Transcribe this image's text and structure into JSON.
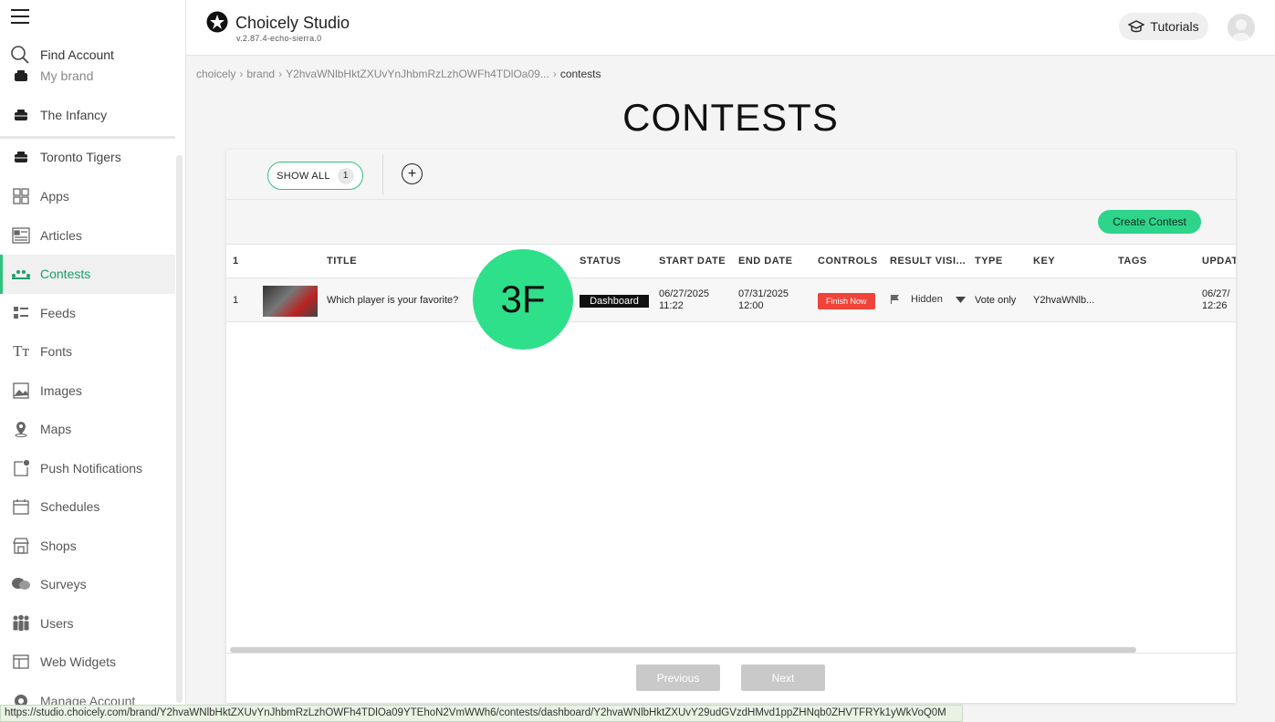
{
  "app": {
    "title": "Choicely Studio",
    "version": "v.2.87.4-echo-sierra.0",
    "tutorials_label": "Tutorials"
  },
  "sidebar": {
    "find_account": "Find Account",
    "clipped_brand": "My brand",
    "brands": [
      {
        "label": "The Infancy"
      },
      {
        "label": "Toronto Tigers"
      }
    ],
    "items": [
      {
        "label": "Apps",
        "icon": "apps-icon"
      },
      {
        "label": "Articles",
        "icon": "articles-icon"
      },
      {
        "label": "Contests",
        "icon": "contests-icon",
        "active": true
      },
      {
        "label": "Feeds",
        "icon": "feeds-icon"
      },
      {
        "label": "Fonts",
        "icon": "fonts-icon"
      },
      {
        "label": "Images",
        "icon": "images-icon"
      },
      {
        "label": "Maps",
        "icon": "maps-icon"
      },
      {
        "label": "Push Notifications",
        "icon": "push-notifications-icon"
      },
      {
        "label": "Schedules",
        "icon": "schedules-icon"
      },
      {
        "label": "Shops",
        "icon": "shops-icon"
      },
      {
        "label": "Surveys",
        "icon": "surveys-icon"
      },
      {
        "label": "Users",
        "icon": "users-icon"
      },
      {
        "label": "Web Widgets",
        "icon": "web-widgets-icon"
      }
    ],
    "manage_account": "Manage Account"
  },
  "breadcrumb": [
    "choicely",
    "brand",
    "Y2hvaWNlbHktZXUvYnJhbmRzLzhOWFh4TDlOa09...",
    "contests"
  ],
  "page_title": "CONTESTS",
  "filters": {
    "show_all_label": "SHOW ALL",
    "show_all_count": "1",
    "add_label": "+"
  },
  "actions": {
    "create_label": "Create Contest"
  },
  "table": {
    "count": "1",
    "columns": {
      "title": "TITLE",
      "status": "STATUS",
      "start": "START DATE",
      "end": "END DATE",
      "controls": "CONTROLS",
      "result": "RESULT VISI...",
      "type": "TYPE",
      "key": "KEY",
      "tags": "TAGS",
      "updated": "UPDAT"
    },
    "rows": [
      {
        "index": "1",
        "title": "Which player is your favorite?",
        "status": "Dashboard",
        "start_date": "06/27/2025",
        "start_time": "11:22",
        "end_date": "07/31/2025",
        "end_time": "12:00",
        "control": "Finish Now",
        "result_visibility": "Hidden",
        "type": "Vote only",
        "key": "Y2hvaWNlb...",
        "tags": "",
        "updated_date": "06/27/",
        "updated_time": "12:26"
      }
    ]
  },
  "overlay_badge": "3F",
  "pager": {
    "previous": "Previous",
    "next": "Next"
  },
  "status_url": "https://studio.choicely.com/brand/Y2hvaWNlbHktZXUvYnJhbmRzLzhOWFh4TDlOa09YTEhoN2VmWWh6/contests/dashboard/Y2hvaWNlbHktZXUvY29udGVzdHMvd1ppZHNqb0ZHVTFRYk1yWkVoQ0M",
  "colors": {
    "accent": "#2ec27e",
    "create_button": "#2ed48a",
    "finish_button": "#f0443a",
    "overlay": "#2ee08a"
  }
}
